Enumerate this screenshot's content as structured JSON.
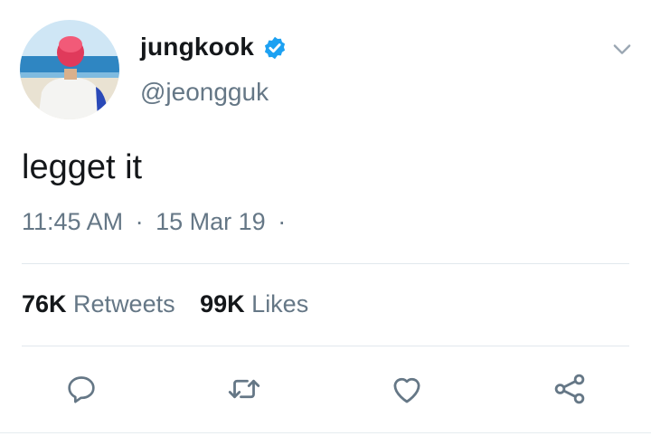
{
  "author": {
    "display_name": "jungkook",
    "handle": "@jeongguk",
    "verified": true
  },
  "tweet": {
    "text": "legget it",
    "time": "11:45 AM",
    "separator": "·",
    "date": "15 Mar 19"
  },
  "stats": {
    "retweets_count": "76K",
    "retweets_label": "Retweets",
    "likes_count": "99K",
    "likes_label": "Likes"
  },
  "icons": {
    "avatar": "profile-photo",
    "verified": "verified-badge-icon",
    "menu": "chevron-down-icon",
    "reply": "reply-icon",
    "retweet": "retweet-icon",
    "like": "heart-icon",
    "share": "share-icon"
  },
  "colors": {
    "verified_blue": "#1da1f2",
    "secondary_text": "#657786",
    "primary_text": "#14171a",
    "divider": "#e1e8ed"
  }
}
